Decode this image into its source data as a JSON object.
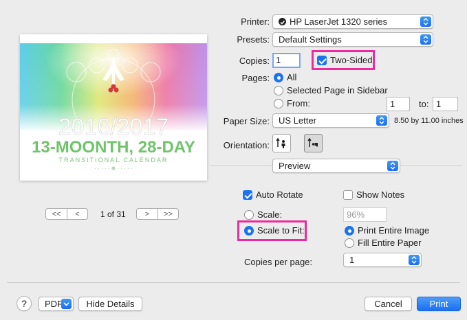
{
  "printer": {
    "label": "Printer:",
    "value": "HP LaserJet 1320 series"
  },
  "presets": {
    "label": "Presets:",
    "value": "Default Settings"
  },
  "copies": {
    "label": "Copies:",
    "value": "1",
    "two_sided": "Two-Sided"
  },
  "pages": {
    "label": "Pages:",
    "all": "All",
    "selected": "Selected Page in Sidebar",
    "from": "From:",
    "from_value": "1",
    "to": "to:",
    "to_value": "1"
  },
  "paper_size": {
    "label": "Paper Size:",
    "value": "US Letter",
    "dimensions": "8.50 by 11.00 inches"
  },
  "orientation": {
    "label": "Orientation:"
  },
  "section_popup": "Preview",
  "options": {
    "auto_rotate": "Auto Rotate",
    "show_notes": "Show Notes",
    "scale": "Scale:",
    "scale_value": "96%",
    "scale_to_fit": "Scale to Fit:",
    "print_entire_image": "Print Entire Image",
    "fill_entire_paper": "Fill Entire Paper",
    "copies_per_page_label": "Copies per page:",
    "copies_per_page_value": "1"
  },
  "preview": {
    "page_indicator": "1 of 31",
    "year_text": "2016/2017",
    "calendar_title": "13-MOONTH, 28-DAY",
    "calendar_subtitle": "TRANSITIONAL CALENDAR"
  },
  "footer": {
    "help": "?",
    "pdf": "PDF",
    "hide_details": "Hide Details",
    "cancel": "Cancel",
    "print": "Print"
  },
  "colors": {
    "accent": "#1b73f0",
    "highlight": "#ec2b9d"
  }
}
